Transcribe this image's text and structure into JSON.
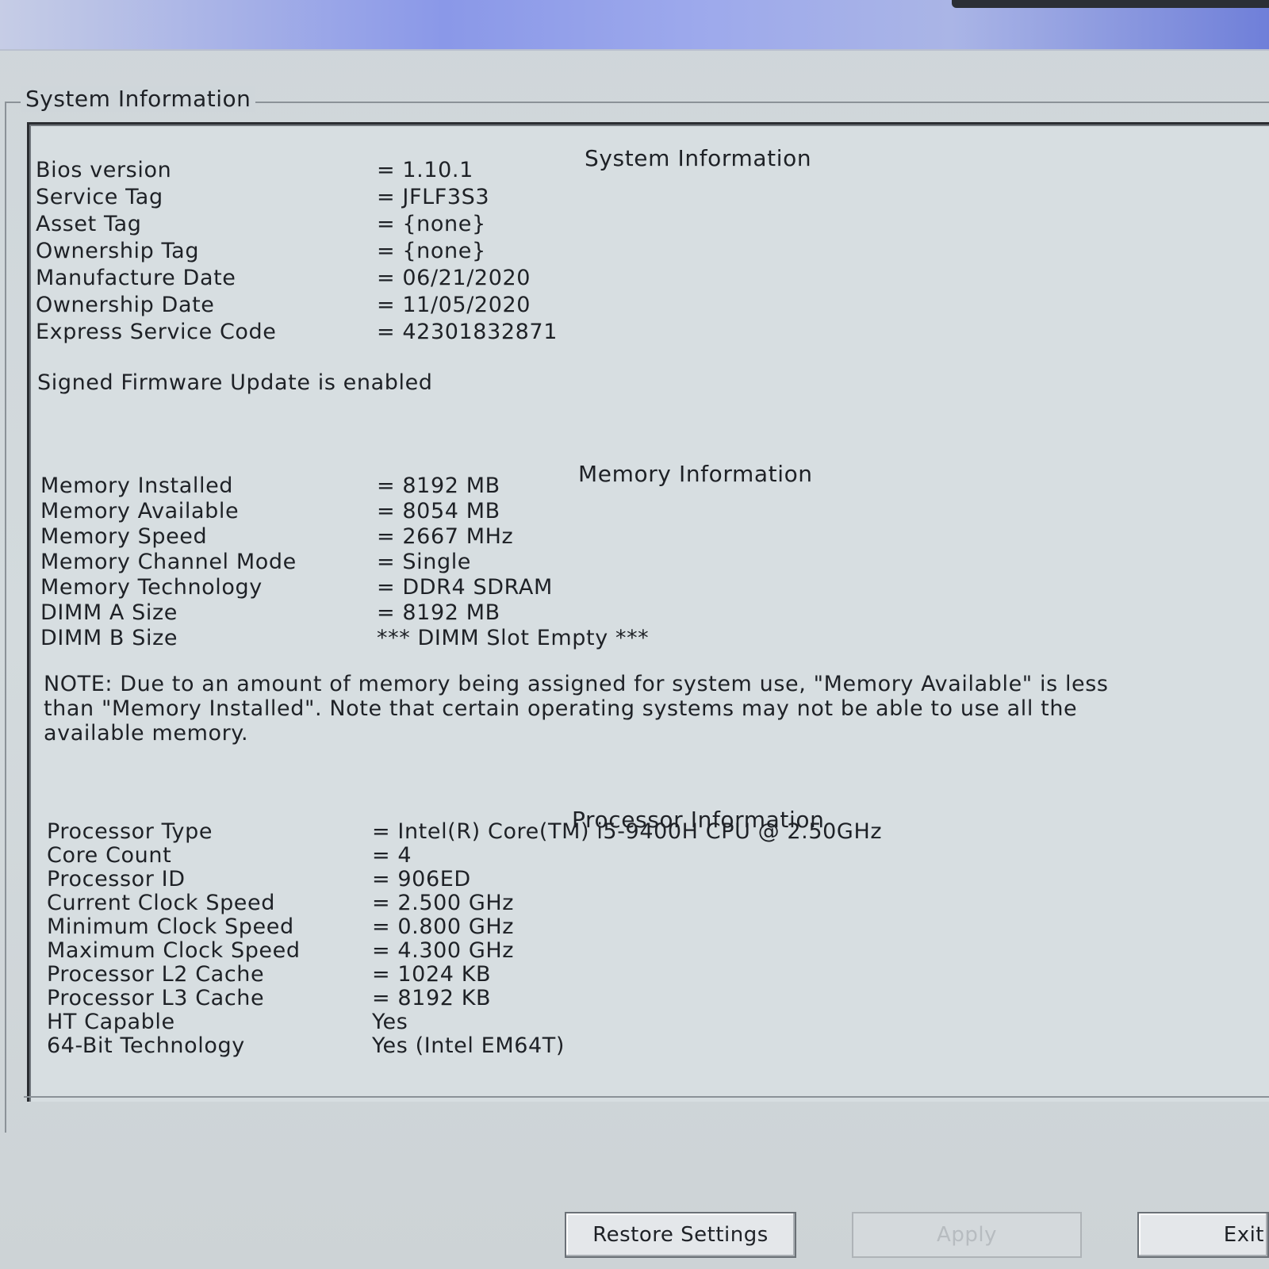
{
  "group": {
    "title": "System Information"
  },
  "system": {
    "title": "System Information",
    "rows": [
      {
        "label": "Bios version",
        "value": "= 1.10.1"
      },
      {
        "label": "Service Tag",
        "value": "= JFLF3S3"
      },
      {
        "label": "Asset Tag",
        "value": "= {none}"
      },
      {
        "label": "Ownership Tag",
        "value": "= {none}"
      },
      {
        "label": "Manufacture Date",
        "value": "= 06/21/2020"
      },
      {
        "label": "Ownership Date",
        "value": "= 11/05/2020"
      },
      {
        "label": "Express Service Code",
        "value": "= 42301832871"
      }
    ],
    "firmware_note": "Signed Firmware Update is enabled"
  },
  "memory": {
    "title": "Memory Information",
    "rows": [
      {
        "label": "Memory Installed",
        "value": "= 8192 MB"
      },
      {
        "label": "Memory Available",
        "value": "= 8054 MB"
      },
      {
        "label": "Memory Speed",
        "value": "= 2667 MHz"
      },
      {
        "label": "Memory Channel Mode",
        "value": "= Single"
      },
      {
        "label": "Memory Technology",
        "value": "= DDR4 SDRAM"
      },
      {
        "label": "DIMM A Size",
        "value": "= 8192 MB"
      },
      {
        "label": "DIMM B Size",
        "value": "*** DIMM Slot Empty ***"
      }
    ],
    "note_lines": [
      "NOTE: Due to an amount of memory being assigned for system use, \"Memory Available\" is less",
      "than \"Memory Installed\". Note that certain operating systems may not be able to use all the",
      "available memory."
    ]
  },
  "processor": {
    "title": "Processor Information",
    "rows": [
      {
        "label": "Processor Type",
        "value": "= Intel(R) Core(TM) i5-9400H CPU @ 2.50GHz"
      },
      {
        "label": "Core Count",
        "value": "= 4"
      },
      {
        "label": "Processor ID",
        "value": "= 906ED"
      },
      {
        "label": "Current Clock Speed",
        "value": "= 2.500 GHz"
      },
      {
        "label": "Minimum Clock Speed",
        "value": "= 0.800 GHz"
      },
      {
        "label": "Maximum Clock Speed",
        "value": "= 4.300 GHz"
      },
      {
        "label": "Processor L2 Cache",
        "value": "= 1024 KB"
      },
      {
        "label": "Processor L3 Cache",
        "value": "= 8192 KB"
      },
      {
        "label": "HT Capable",
        "value": "Yes"
      },
      {
        "label": "64-Bit Technology",
        "value": "Yes (Intel EM64T)"
      }
    ]
  },
  "buttons": {
    "restore": "Restore Settings",
    "apply": "Apply",
    "exit": "Exit"
  }
}
